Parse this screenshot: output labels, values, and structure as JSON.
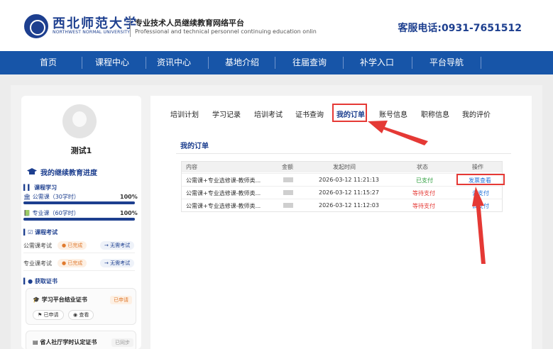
{
  "header": {
    "logo_cn": "西北师范大学",
    "logo_en": "NORTHWEST NORMAL UNIVERSITY",
    "platform_title": "专业技术人员继续教育网络平台",
    "platform_subtitle": "Professional and technical personnel continuing education onlin",
    "hotline": "客服电话:0931-7651512"
  },
  "nav": {
    "items": [
      "首页",
      "课程中心",
      "资讯中心",
      "基地介绍",
      "往届查询",
      "补学入口",
      "平台导航"
    ]
  },
  "profile": {
    "name": "测试1",
    "progress_title": "我的继续教育进度",
    "course_section": "课程学习",
    "public_course": {
      "label": "公需课（30学时）",
      "percent": "100%",
      "fraction": 1.0
    },
    "major_course": {
      "label": "专业课（60学时）",
      "percent": "100%",
      "fraction": 1.0
    },
    "exam_section": "课程考试",
    "exams": [
      {
        "label": "公需课考试",
        "status": "● 已完成",
        "action": "→ 无需考试"
      },
      {
        "label": "专业课考试",
        "status": "● 已完成",
        "action": "→ 无需考试"
      }
    ],
    "cert_section": "获取证书",
    "certs": [
      {
        "title": "学习平台结业证书",
        "badge": "已申请",
        "btn1": "已申请",
        "btn2": "查看"
      },
      {
        "title": "省人社厅学时认定证书",
        "badge": "已同步"
      }
    ]
  },
  "tabs": [
    "培训计划",
    "学习记录",
    "培训考试",
    "证书查询",
    "我的订单",
    "账号信息",
    "职称信息",
    "我的评价"
  ],
  "active_tab": "我的订单",
  "orders": {
    "heading": "我的订单",
    "columns": [
      "内容",
      "金额",
      "发起时间",
      "状态",
      "操作"
    ],
    "rows": [
      {
        "content": "公需课+专业选修课-教师类...",
        "time": "2026-03-12 11:21:13",
        "status": "已支付",
        "action": "发票查看"
      },
      {
        "content": "公需课+专业选修课-教师类...",
        "time": "2026-03-12 11:15:27",
        "status": "等待支付",
        "action": "去支付"
      },
      {
        "content": "公需课+专业选修课-教师类...",
        "time": "2026-03-12 11:12:03",
        "status": "等待支付",
        "action": "去支付"
      }
    ]
  },
  "colors": {
    "brand_blue": "#1755a8",
    "highlight_red": "#e53935",
    "paid_green": "#2e9e3e"
  }
}
